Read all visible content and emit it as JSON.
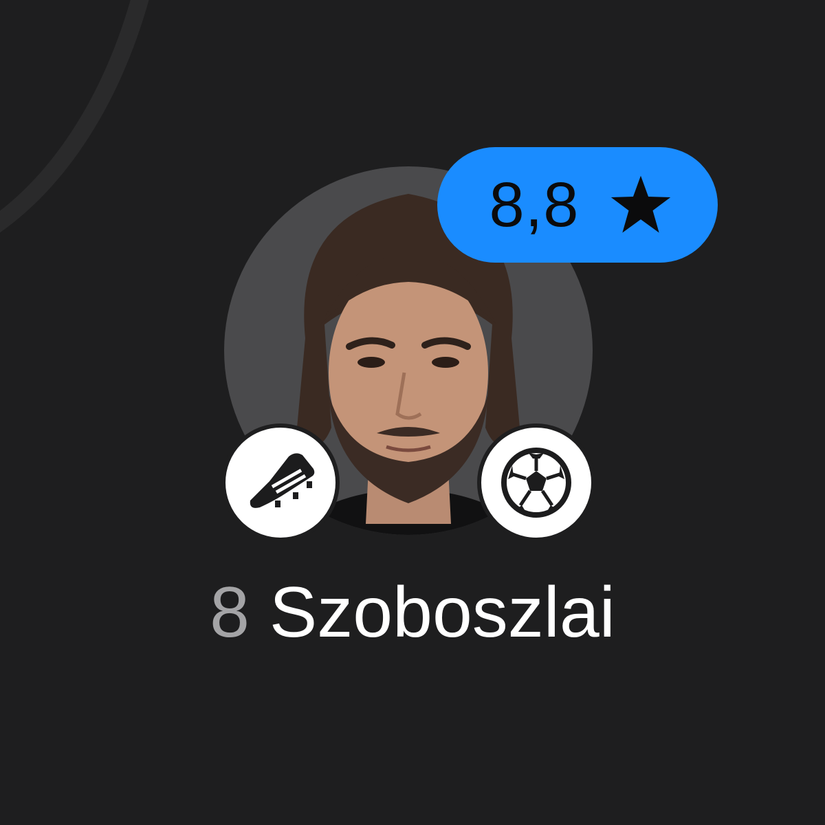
{
  "player": {
    "number": "8",
    "name": "Szoboszlai",
    "rating": "8,8",
    "rating_icon": "star-icon",
    "badges": [
      {
        "icon": "football-boot-icon",
        "meaning": "assist"
      },
      {
        "icon": "football-icon",
        "meaning": "goal"
      }
    ]
  },
  "colors": {
    "background": "#1e1e1f",
    "rating_badge": "#1a8cff",
    "avatar_background": "#4a4a4c",
    "number_text": "#a4a4a6",
    "name_text": "#ffffff"
  }
}
